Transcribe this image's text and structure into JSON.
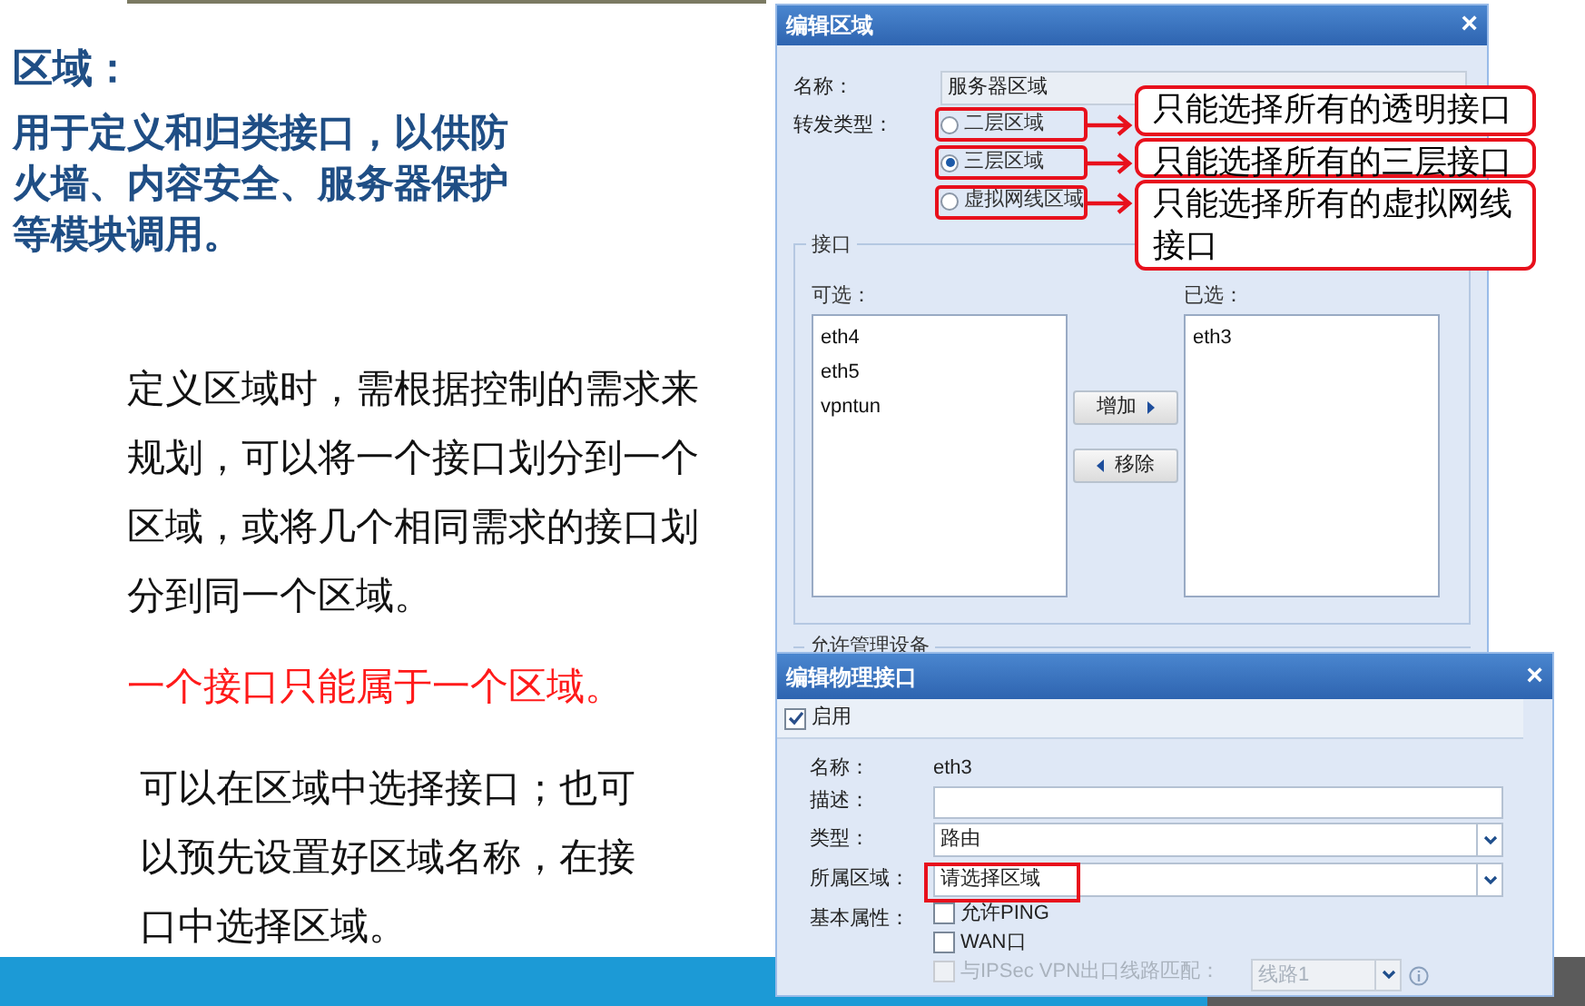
{
  "slide": {
    "heading": "区域：",
    "summary": "用于定义和归类接口，以供防火墙、内容安全、服务器保护等模块调用。",
    "paragraphs": [
      {
        "kind": "normal",
        "text": "定义区域时，需根据控制的需求来规划，可以将一个接口划分到一个区域，或将几个相同需求的接口划分到同一个区域。"
      },
      {
        "kind": "highlight",
        "text": "一个接口只能属于一个区域。"
      },
      {
        "kind": "normal",
        "text": "可以在区域中选择接口；也可以预先设置好区域名称，在接口中选择区域。"
      }
    ]
  },
  "zone_dialog": {
    "title": "编辑区域",
    "close": "×",
    "name_label": "名称：",
    "name_value": "服务器区域",
    "forward_label": "转发类型：",
    "forward_types": [
      {
        "label": "二层区域",
        "selected": false
      },
      {
        "label": "三层区域",
        "selected": true
      },
      {
        "label": "虚拟网线区域",
        "selected": false
      }
    ],
    "callouts": [
      "只能选择所有的透明接口",
      "只能选择所有的三层接口",
      "只能选择所有的虚拟网线接口"
    ],
    "interfaces": {
      "legend": "接口",
      "available_label": "可选：",
      "available": [
        "eth4",
        "eth5",
        "vpntun"
      ],
      "selected_label": "已选：",
      "selected": [
        "eth3"
      ],
      "add_button": "增加",
      "remove_button": "移除"
    },
    "next_section_legend": "允许管理设备"
  },
  "interface_dialog": {
    "title": "编辑物理接口",
    "close": "×",
    "enable": {
      "label": "启用",
      "checked": true
    },
    "name_label": "名称：",
    "name_value": "eth3",
    "description_label": "描述：",
    "type_label": "类型：",
    "type_value": "路由",
    "zone_label": "所属区域：",
    "zone_placeholder": "请选择区域",
    "basic_label": "基本属性：",
    "options": [
      {
        "label": "允许PING",
        "checked": false,
        "disabled": false
      },
      {
        "label": "WAN口",
        "checked": false,
        "disabled": false
      },
      {
        "label": "与IPSec VPN出口线路匹配：",
        "checked": false,
        "disabled": true,
        "line_value": "线路1"
      }
    ]
  }
}
